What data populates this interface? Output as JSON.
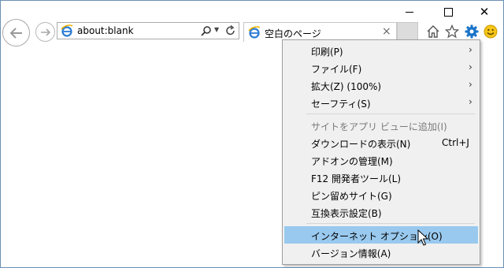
{
  "window": {
    "caption": {
      "close_glyph": "✕"
    }
  },
  "address_bar": {
    "url": "about:blank"
  },
  "tab": {
    "title": "空白のページ",
    "close_glyph": "×"
  },
  "icons": {
    "back": "back-arrow-icon",
    "forward": "forward-arrow-icon",
    "ie": "internet-explorer-icon",
    "search": "search-icon",
    "refresh": "refresh-icon",
    "home": "home-icon",
    "favorites": "star-icon",
    "tools": "gear-icon",
    "feedback": "smiley-icon"
  },
  "menu": {
    "items": [
      {
        "label": "印刷(P)",
        "submenu": true
      },
      {
        "label": "ファイル(F)",
        "submenu": true
      },
      {
        "label": "拡大(Z) (100%)",
        "submenu": true
      },
      {
        "label": "セーフティ(S)",
        "submenu": true
      },
      {
        "label": "サイトをアプリ ビューに追加(I)",
        "disabled": true
      },
      {
        "label": "ダウンロードの表示(N)",
        "shortcut": "Ctrl+J"
      },
      {
        "label": "アドオンの管理(M)"
      },
      {
        "label": "F12 開発者ツール(L)"
      },
      {
        "label": "ピン留めサイト(G)"
      },
      {
        "label": "互換表示設定(B)"
      },
      {
        "label": "インターネット オプション(O)",
        "highlighted": true
      },
      {
        "label": "バージョン情報(A)"
      }
    ],
    "submenu_arrow": "›"
  },
  "colors": {
    "accent": "#1a73c9",
    "highlight": "#99c9ef",
    "menu_bg": "#f0f0f0",
    "smiley": "#f5c518"
  }
}
